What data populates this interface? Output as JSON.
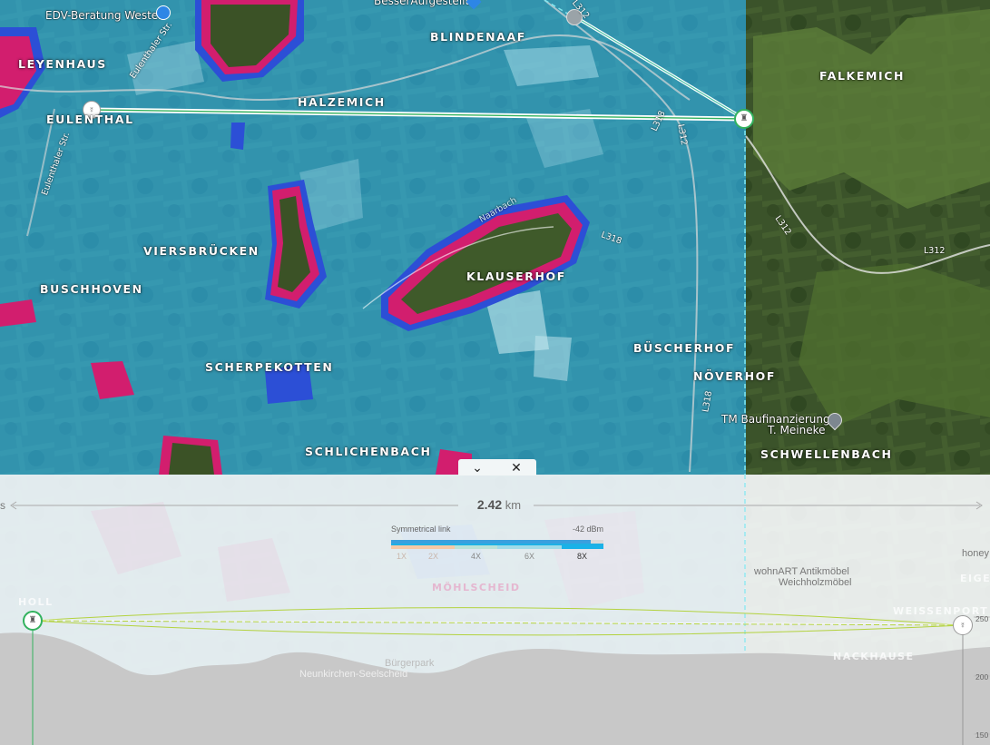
{
  "map": {
    "places": [
      {
        "name": "LEYENHAUS"
      },
      {
        "name": "EULENTHAL"
      },
      {
        "name": "HALZEMICH"
      },
      {
        "name": "BLINDENAAF"
      },
      {
        "name": "FALKEMICH"
      },
      {
        "name": "VIERSBRÜCKEN"
      },
      {
        "name": "BUSCHHOVEN"
      },
      {
        "name": "KLAUSERHOF"
      },
      {
        "name": "SCHERPEKOTTEN"
      },
      {
        "name": "BÜSCHERHOF"
      },
      {
        "name": "NÖVERHOF"
      },
      {
        "name": "SCHLICHENBACH"
      },
      {
        "name": "SCHWELLENBACH"
      }
    ],
    "roads": [
      "Eulenthaler Str.",
      "Eulenthaler Str.",
      "L312",
      "L318",
      "L312",
      "L312",
      "L318",
      "L312",
      "L318",
      "Naarbach"
    ],
    "pois": [
      {
        "name": "EDV-Beratung Wester",
        "icon": "pin-icon"
      },
      {
        "name": "BesserAufgestellt",
        "icon": "pin-icon"
      },
      {
        "name": "TM Baufinanzierung",
        "icon": "pin-icon"
      },
      {
        "name": "T. Meineke",
        "icon": "pin-icon"
      }
    ],
    "colors": {
      "coverage": "#29a8d6",
      "weak_signal": "#d21e6e",
      "edge_signal": "#2c4fd6",
      "link_line": "#ffffff"
    }
  },
  "panel": {
    "distance_value": "2.42",
    "distance_unit": "km",
    "left_edge_text": "s",
    "legend_title": "Symmetrical link",
    "legend_dbm": "-42  dBm",
    "modulations": [
      "1X",
      "2X",
      "4X",
      "6X",
      "8X"
    ],
    "altitudes": [
      "250",
      "200",
      "150"
    ],
    "background_labels": [
      "HOLL",
      "MÖHLSCHEID",
      "WEISSENPORT",
      "NACKHAUSE",
      "EIGE",
      "honey"
    ],
    "background_pois": [
      "Neunkirchen-Seelscheid",
      "Bürgerpark",
      "wohnART Antikmöbel",
      "Weichholzmöbel"
    ],
    "collapse_icon": "chevron-down-icon",
    "close_icon": "close-icon"
  }
}
